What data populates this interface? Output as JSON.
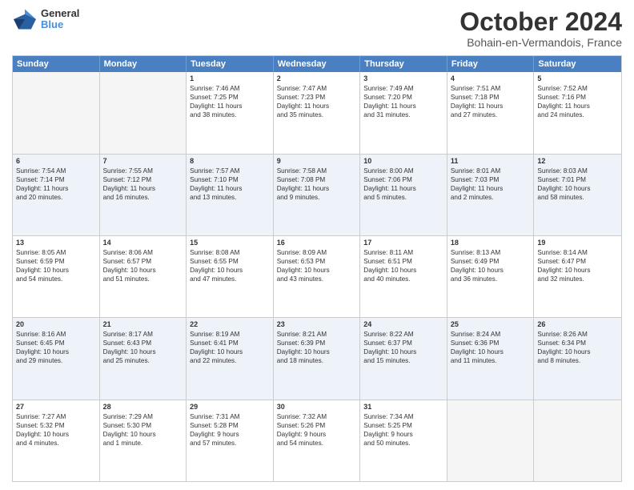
{
  "logo": {
    "text1": "General",
    "text2": "Blue"
  },
  "title": "October 2024",
  "subtitle": "Bohain-en-Vermandois, France",
  "header_days": [
    "Sunday",
    "Monday",
    "Tuesday",
    "Wednesday",
    "Thursday",
    "Friday",
    "Saturday"
  ],
  "rows": [
    {
      "alt": false,
      "cells": [
        {
          "day": "",
          "lines": []
        },
        {
          "day": "",
          "lines": []
        },
        {
          "day": "1",
          "lines": [
            "Sunrise: 7:46 AM",
            "Sunset: 7:25 PM",
            "Daylight: 11 hours",
            "and 38 minutes."
          ]
        },
        {
          "day": "2",
          "lines": [
            "Sunrise: 7:47 AM",
            "Sunset: 7:23 PM",
            "Daylight: 11 hours",
            "and 35 minutes."
          ]
        },
        {
          "day": "3",
          "lines": [
            "Sunrise: 7:49 AM",
            "Sunset: 7:20 PM",
            "Daylight: 11 hours",
            "and 31 minutes."
          ]
        },
        {
          "day": "4",
          "lines": [
            "Sunrise: 7:51 AM",
            "Sunset: 7:18 PM",
            "Daylight: 11 hours",
            "and 27 minutes."
          ]
        },
        {
          "day": "5",
          "lines": [
            "Sunrise: 7:52 AM",
            "Sunset: 7:16 PM",
            "Daylight: 11 hours",
            "and 24 minutes."
          ]
        }
      ]
    },
    {
      "alt": true,
      "cells": [
        {
          "day": "6",
          "lines": [
            "Sunrise: 7:54 AM",
            "Sunset: 7:14 PM",
            "Daylight: 11 hours",
            "and 20 minutes."
          ]
        },
        {
          "day": "7",
          "lines": [
            "Sunrise: 7:55 AM",
            "Sunset: 7:12 PM",
            "Daylight: 11 hours",
            "and 16 minutes."
          ]
        },
        {
          "day": "8",
          "lines": [
            "Sunrise: 7:57 AM",
            "Sunset: 7:10 PM",
            "Daylight: 11 hours",
            "and 13 minutes."
          ]
        },
        {
          "day": "9",
          "lines": [
            "Sunrise: 7:58 AM",
            "Sunset: 7:08 PM",
            "Daylight: 11 hours",
            "and 9 minutes."
          ]
        },
        {
          "day": "10",
          "lines": [
            "Sunrise: 8:00 AM",
            "Sunset: 7:06 PM",
            "Daylight: 11 hours",
            "and 5 minutes."
          ]
        },
        {
          "day": "11",
          "lines": [
            "Sunrise: 8:01 AM",
            "Sunset: 7:03 PM",
            "Daylight: 11 hours",
            "and 2 minutes."
          ]
        },
        {
          "day": "12",
          "lines": [
            "Sunrise: 8:03 AM",
            "Sunset: 7:01 PM",
            "Daylight: 10 hours",
            "and 58 minutes."
          ]
        }
      ]
    },
    {
      "alt": false,
      "cells": [
        {
          "day": "13",
          "lines": [
            "Sunrise: 8:05 AM",
            "Sunset: 6:59 PM",
            "Daylight: 10 hours",
            "and 54 minutes."
          ]
        },
        {
          "day": "14",
          "lines": [
            "Sunrise: 8:06 AM",
            "Sunset: 6:57 PM",
            "Daylight: 10 hours",
            "and 51 minutes."
          ]
        },
        {
          "day": "15",
          "lines": [
            "Sunrise: 8:08 AM",
            "Sunset: 6:55 PM",
            "Daylight: 10 hours",
            "and 47 minutes."
          ]
        },
        {
          "day": "16",
          "lines": [
            "Sunrise: 8:09 AM",
            "Sunset: 6:53 PM",
            "Daylight: 10 hours",
            "and 43 minutes."
          ]
        },
        {
          "day": "17",
          "lines": [
            "Sunrise: 8:11 AM",
            "Sunset: 6:51 PM",
            "Daylight: 10 hours",
            "and 40 minutes."
          ]
        },
        {
          "day": "18",
          "lines": [
            "Sunrise: 8:13 AM",
            "Sunset: 6:49 PM",
            "Daylight: 10 hours",
            "and 36 minutes."
          ]
        },
        {
          "day": "19",
          "lines": [
            "Sunrise: 8:14 AM",
            "Sunset: 6:47 PM",
            "Daylight: 10 hours",
            "and 32 minutes."
          ]
        }
      ]
    },
    {
      "alt": true,
      "cells": [
        {
          "day": "20",
          "lines": [
            "Sunrise: 8:16 AM",
            "Sunset: 6:45 PM",
            "Daylight: 10 hours",
            "and 29 minutes."
          ]
        },
        {
          "day": "21",
          "lines": [
            "Sunrise: 8:17 AM",
            "Sunset: 6:43 PM",
            "Daylight: 10 hours",
            "and 25 minutes."
          ]
        },
        {
          "day": "22",
          "lines": [
            "Sunrise: 8:19 AM",
            "Sunset: 6:41 PM",
            "Daylight: 10 hours",
            "and 22 minutes."
          ]
        },
        {
          "day": "23",
          "lines": [
            "Sunrise: 8:21 AM",
            "Sunset: 6:39 PM",
            "Daylight: 10 hours",
            "and 18 minutes."
          ]
        },
        {
          "day": "24",
          "lines": [
            "Sunrise: 8:22 AM",
            "Sunset: 6:37 PM",
            "Daylight: 10 hours",
            "and 15 minutes."
          ]
        },
        {
          "day": "25",
          "lines": [
            "Sunrise: 8:24 AM",
            "Sunset: 6:36 PM",
            "Daylight: 10 hours",
            "and 11 minutes."
          ]
        },
        {
          "day": "26",
          "lines": [
            "Sunrise: 8:26 AM",
            "Sunset: 6:34 PM",
            "Daylight: 10 hours",
            "and 8 minutes."
          ]
        }
      ]
    },
    {
      "alt": false,
      "cells": [
        {
          "day": "27",
          "lines": [
            "Sunrise: 7:27 AM",
            "Sunset: 5:32 PM",
            "Daylight: 10 hours",
            "and 4 minutes."
          ]
        },
        {
          "day": "28",
          "lines": [
            "Sunrise: 7:29 AM",
            "Sunset: 5:30 PM",
            "Daylight: 10 hours",
            "and 1 minute."
          ]
        },
        {
          "day": "29",
          "lines": [
            "Sunrise: 7:31 AM",
            "Sunset: 5:28 PM",
            "Daylight: 9 hours",
            "and 57 minutes."
          ]
        },
        {
          "day": "30",
          "lines": [
            "Sunrise: 7:32 AM",
            "Sunset: 5:26 PM",
            "Daylight: 9 hours",
            "and 54 minutes."
          ]
        },
        {
          "day": "31",
          "lines": [
            "Sunrise: 7:34 AM",
            "Sunset: 5:25 PM",
            "Daylight: 9 hours",
            "and 50 minutes."
          ]
        },
        {
          "day": "",
          "lines": []
        },
        {
          "day": "",
          "lines": []
        }
      ]
    }
  ]
}
